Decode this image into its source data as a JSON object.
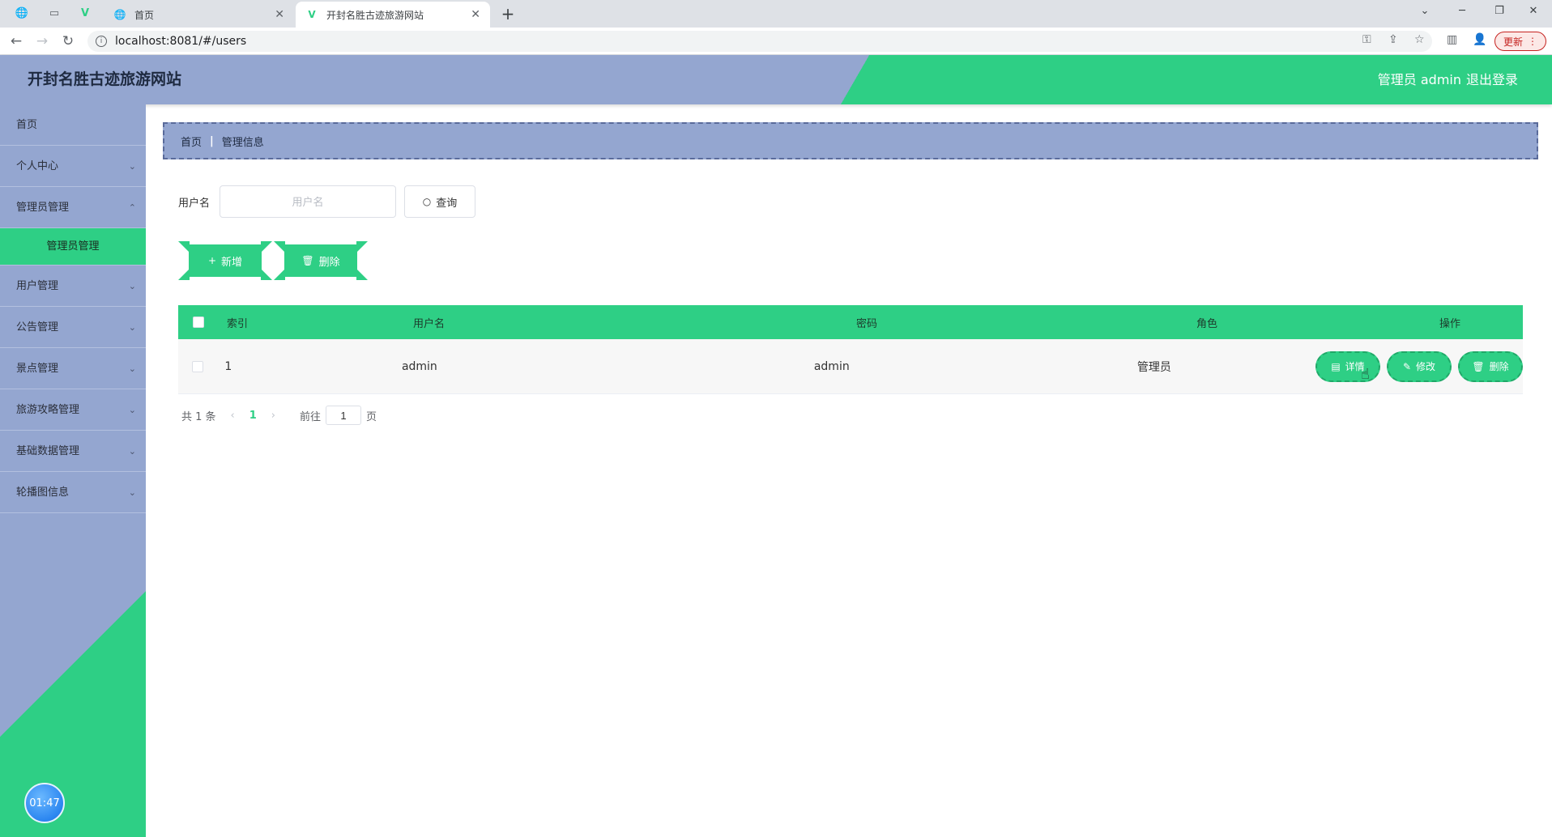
{
  "browser": {
    "tabs": [
      {
        "title": "首页",
        "active": false
      },
      {
        "title": "开封名胜古迹旅游网站",
        "active": true
      }
    ],
    "url": "localhost:8081/#/users",
    "update_label": "更新"
  },
  "header": {
    "title": "开封名胜古迹旅游网站",
    "user": "管理员 admin",
    "logout": "退出登录"
  },
  "sidebar": {
    "items": [
      {
        "label": "首页"
      },
      {
        "label": "个人中心"
      },
      {
        "label": "管理员管理"
      },
      {
        "label": "管理员管理"
      },
      {
        "label": "用户管理"
      },
      {
        "label": "公告管理"
      },
      {
        "label": "景点管理"
      },
      {
        "label": "旅游攻略管理"
      },
      {
        "label": "基础数据管理"
      },
      {
        "label": "轮播图信息"
      }
    ],
    "clock": "01:47"
  },
  "breadcrumb": {
    "home": "首页",
    "current": "管理信息"
  },
  "search": {
    "label": "用户名",
    "placeholder": "用户名",
    "value": "",
    "button": "查询"
  },
  "actions": {
    "add": "新增",
    "delete": "删除"
  },
  "table": {
    "headers": {
      "index": "索引",
      "username": "用户名",
      "password": "密码",
      "role": "角色",
      "ops": "操作"
    },
    "rows": [
      {
        "index": "1",
        "username": "admin",
        "password": "admin",
        "role": "管理员"
      }
    ],
    "row_ops": {
      "detail": "详情",
      "edit": "修改",
      "delete": "删除"
    }
  },
  "pagination": {
    "total": "共 1 条",
    "current": "1",
    "goto": "前往",
    "page_value": "1",
    "page_suffix": "页"
  },
  "colors": {
    "accent": "#2ecf85",
    "primary": "#94a6d0"
  }
}
